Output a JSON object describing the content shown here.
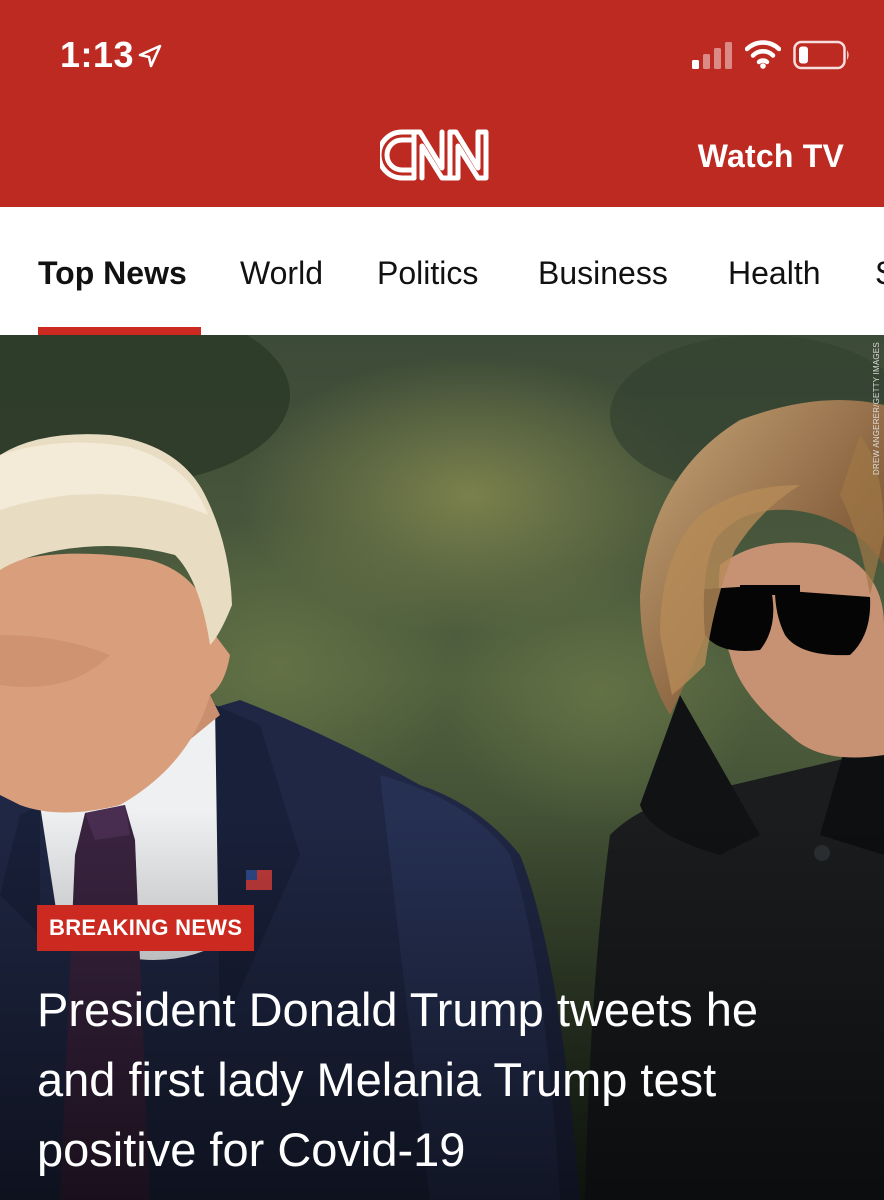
{
  "status_bar": {
    "time": "1:13",
    "icons": [
      "location-arrow-icon",
      "cellular-signal-icon",
      "wifi-icon",
      "battery-icon"
    ]
  },
  "header": {
    "logo_text": "CNN",
    "watch_tv_label": "Watch TV",
    "background_color": "#bd2a21"
  },
  "tabs": [
    {
      "label": "Top News",
      "active": true
    },
    {
      "label": "World",
      "active": false
    },
    {
      "label": "Politics",
      "active": false
    },
    {
      "label": "Business",
      "active": false
    },
    {
      "label": "Health",
      "active": false
    },
    {
      "label": "S",
      "active": false
    }
  ],
  "hero": {
    "photo_credit": "DREW ANGERER/GETTY IMAGES",
    "badge": "BREAKING NEWS",
    "headline": "President Donald Trump tweets he and first lady Melania Trump test positive for Covid-19"
  },
  "colors": {
    "accent": "#cc2a20",
    "tab_text": "#111111"
  }
}
